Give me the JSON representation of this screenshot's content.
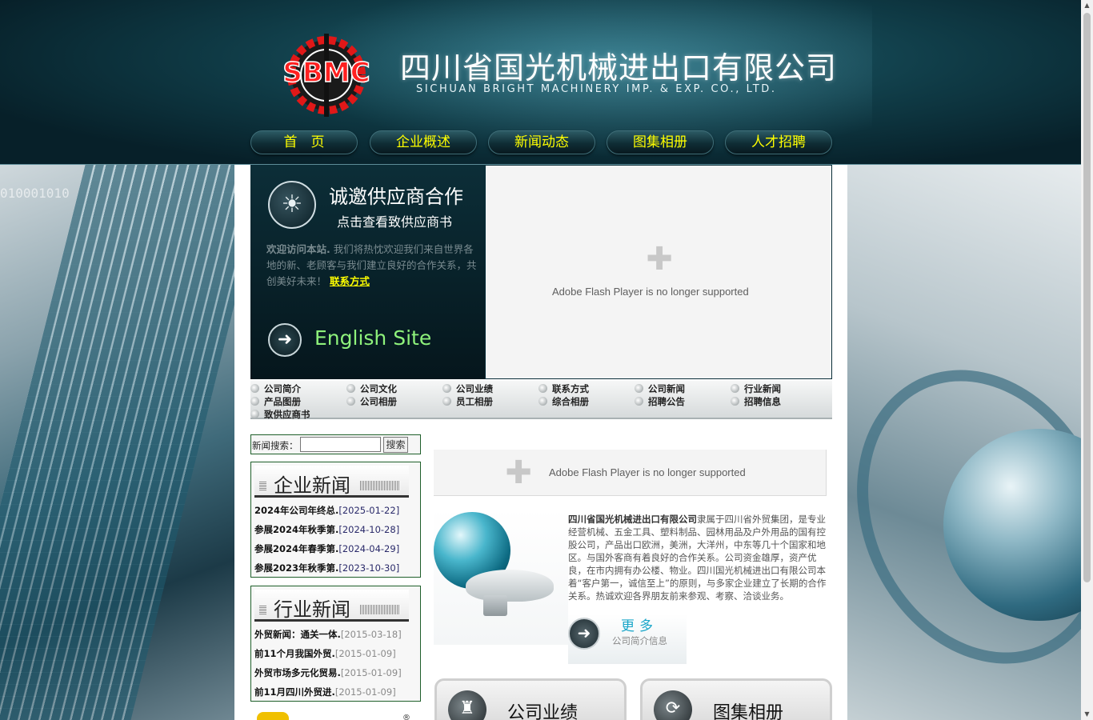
{
  "header": {
    "logo_text": "SBMC",
    "company_cn": "四川省国光机械进出口有限公司",
    "company_en": "SICHUAN BRIGHT MACHINERY IMP. & EXP. CO., LTD."
  },
  "nav": [
    "首　页",
    "企业概述",
    "新闻动态",
    "图集相册",
    "人才招聘"
  ],
  "side_left_bits": "010001010",
  "promo": {
    "title": "诚邀供应商合作",
    "subtitle": "点击查看致供应商书",
    "welcome_bold": "欢迎访问本站.",
    "welcome_text": "我们将热忱欢迎我们来自世界各地的新、老顾客与我们建立良好的合作关系，共创美好未来！",
    "contact_link": "联系方式",
    "english_site": "English Site"
  },
  "flash": {
    "message": "Adobe Flash Player is no longer supported"
  },
  "quicklinks": [
    "公司简介",
    "公司文化",
    "公司业绩",
    "联系方式",
    "公司新闻",
    "行业新闻",
    "产品图册",
    "公司相册",
    "员工相册",
    "综合相册",
    "招聘公告",
    "招聘信息",
    "致供应商书"
  ],
  "search": {
    "label": "新闻搜索：",
    "value": "",
    "button": "搜索"
  },
  "company_news": {
    "title": "企业新闻",
    "items": [
      {
        "title": "2024年公司年终总.",
        "date": "[2025-01-22]"
      },
      {
        "title": "参展2024年秋季第.",
        "date": "[2024-10-28]"
      },
      {
        "title": "参展2024年春季第.",
        "date": "[2024-04-29]"
      },
      {
        "title": "参展2023年秋季第.",
        "date": "[2023-10-30]"
      }
    ]
  },
  "industry_news": {
    "title": "行业新闻",
    "items": [
      {
        "title": "外贸新闻：通关一体.",
        "date": "[2015-03-18]"
      },
      {
        "title": "前11个月我国外贸.",
        "date": "[2015-01-09]"
      },
      {
        "title": "外贸市场多元化贸易.",
        "date": "[2015-01-09]"
      },
      {
        "title": "前11月四川外贸进.",
        "date": "[2015-01-09]"
      }
    ]
  },
  "intro": {
    "company_bold": "四川省国光机械进出口有限公司",
    "text": "隶属于四川省外贸集团，是专业经营机械、五金工具、塑料制品、园林用品及户外用品的国有控股公司，产品出口欧洲，美洲，大洋州，中东等几十个国家和地区。与国外客商有着良好的合作关系。公司资金雄厚，资产优良，在市内拥有办公楼、物业。四川国光机械进出口有限公司本着“客户第一，诚信至上”的原则，与多家企业建立了长期的合作关系。热诚欢迎各界朋友前来参观、考察、洽谈业务。",
    "more_title": "更多",
    "more_sub": "公司简介信息"
  },
  "cards": [
    {
      "title": "公司业绩",
      "icon": "trophy-icon"
    },
    {
      "title": "图集相册",
      "icon": "photo-icon"
    }
  ],
  "colors": {
    "nav_text": "#ffff00",
    "english_site": "#8ef27b",
    "box_border": "#1f5f2a",
    "more_title": "#1aa6c9"
  }
}
